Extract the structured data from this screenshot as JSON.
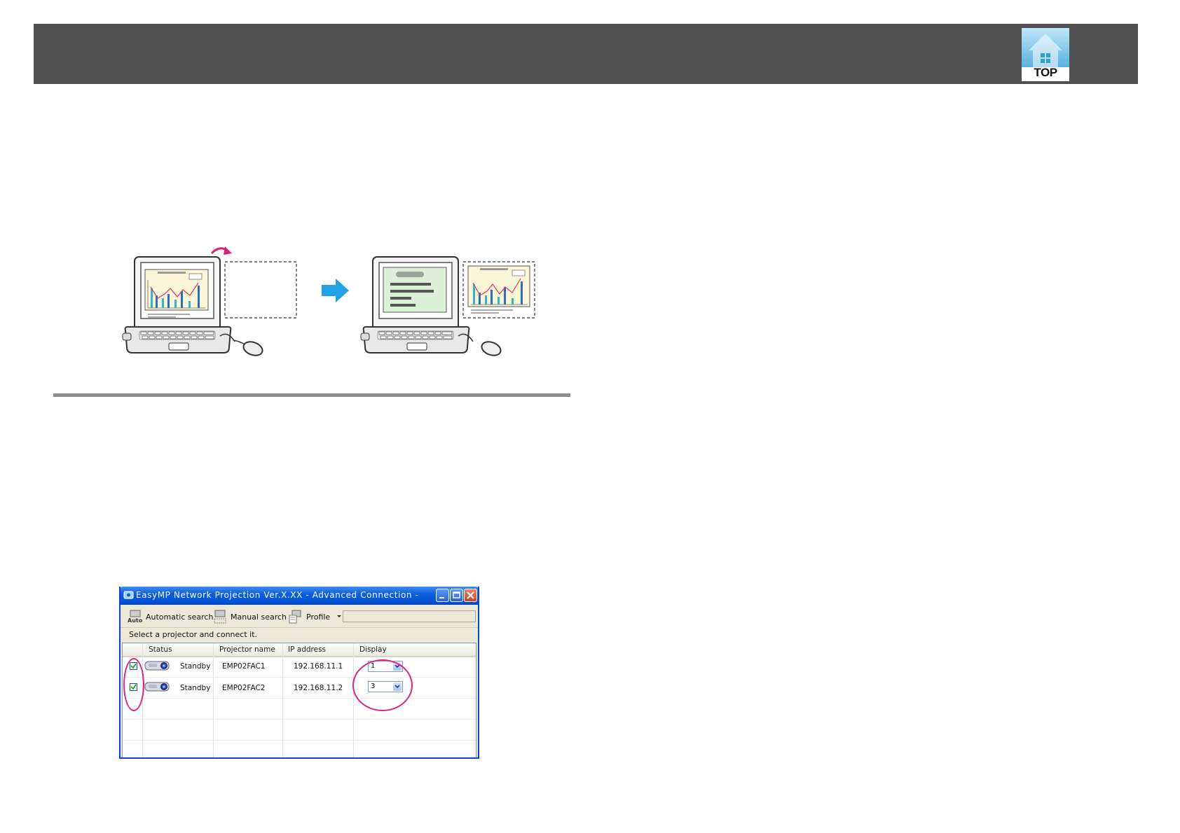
{
  "header": {
    "top_button_label": "TOP"
  },
  "dialog": {
    "title": "EasyMP Network Projection Ver.X.XX - Advanced Connection -",
    "toolbar": {
      "auto_icon_text": "Auto",
      "automatic_search_label": "Automatic search",
      "manual_search_label": "Manual search",
      "profile_label": "Profile"
    },
    "instruction": "Select a projector and connect it.",
    "columns": [
      "Status",
      "Projector name",
      "IP address",
      "Display"
    ],
    "rows": [
      {
        "checked": true,
        "status": "Standby",
        "name": "EMP02FAC1",
        "ip": "192.168.11.1",
        "display": "1"
      },
      {
        "checked": true,
        "status": "Standby",
        "name": "EMP02FAC2",
        "ip": "192.168.11.2",
        "display": "3"
      }
    ]
  },
  "colors": {
    "header_bar": "#505050",
    "accent_arrow": "#1fa3e6",
    "callout": "#e0217e",
    "titlebar": "#0454d6"
  },
  "icons": [
    "top-house-icon",
    "laptop-icon",
    "mouse-icon",
    "arrow-right-icon",
    "rotate-arrow-icon",
    "projector-icon"
  ]
}
